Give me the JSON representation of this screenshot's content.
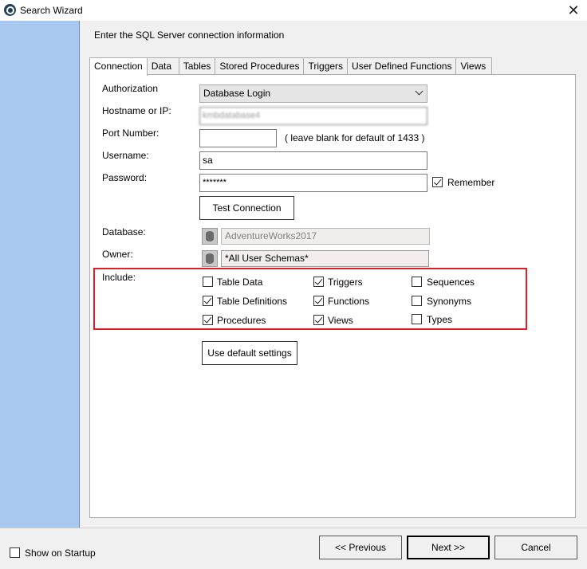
{
  "window": {
    "title": "Search Wizard"
  },
  "header": {
    "text": "Enter the SQL Server connection information"
  },
  "tabs": [
    {
      "label": "Connection"
    },
    {
      "label": "Data"
    },
    {
      "label": "Tables"
    },
    {
      "label": "Stored Procedures"
    },
    {
      "label": "Triggers"
    },
    {
      "label": "User Defined Functions"
    },
    {
      "label": "Views"
    }
  ],
  "form": {
    "authorization_label": "Authorization",
    "authorization_value": "Database Login",
    "hostname_label": "Hostname or IP:",
    "hostname_value": "kmbdatabase4",
    "port_label": "Port Number:",
    "port_value": "",
    "port_hint": "( leave blank for default of 1433 )",
    "username_label": "Username:",
    "username_value": "sa",
    "password_label": "Password:",
    "password_value": "*******",
    "remember_label": "Remember",
    "remember_checked": true,
    "test_connection_label": "Test Connection",
    "database_label": "Database:",
    "database_value": "AdventureWorks2017",
    "owner_label": "Owner:",
    "owner_value": "*All User Schemas*",
    "include_label": "Include:",
    "default_settings_label": "Use default settings"
  },
  "include_options": [
    {
      "label": "Table Data",
      "checked": false
    },
    {
      "label": "Triggers",
      "checked": true
    },
    {
      "label": "Sequences",
      "checked": false
    },
    {
      "label": "Table Definitions",
      "checked": true
    },
    {
      "label": "Functions",
      "checked": true
    },
    {
      "label": "Synonyms",
      "checked": false
    },
    {
      "label": "Procedures",
      "checked": true
    },
    {
      "label": "Views",
      "checked": true
    },
    {
      "label": "Types",
      "checked": false
    }
  ],
  "footer": {
    "show_on_startup_label": "Show on Startup",
    "show_on_startup_checked": false,
    "previous_label": "<< Previous",
    "next_label": "Next >>",
    "cancel_label": "Cancel"
  },
  "colors": {
    "side_panel": "#a8c8f0",
    "highlight": "#e41e26"
  }
}
